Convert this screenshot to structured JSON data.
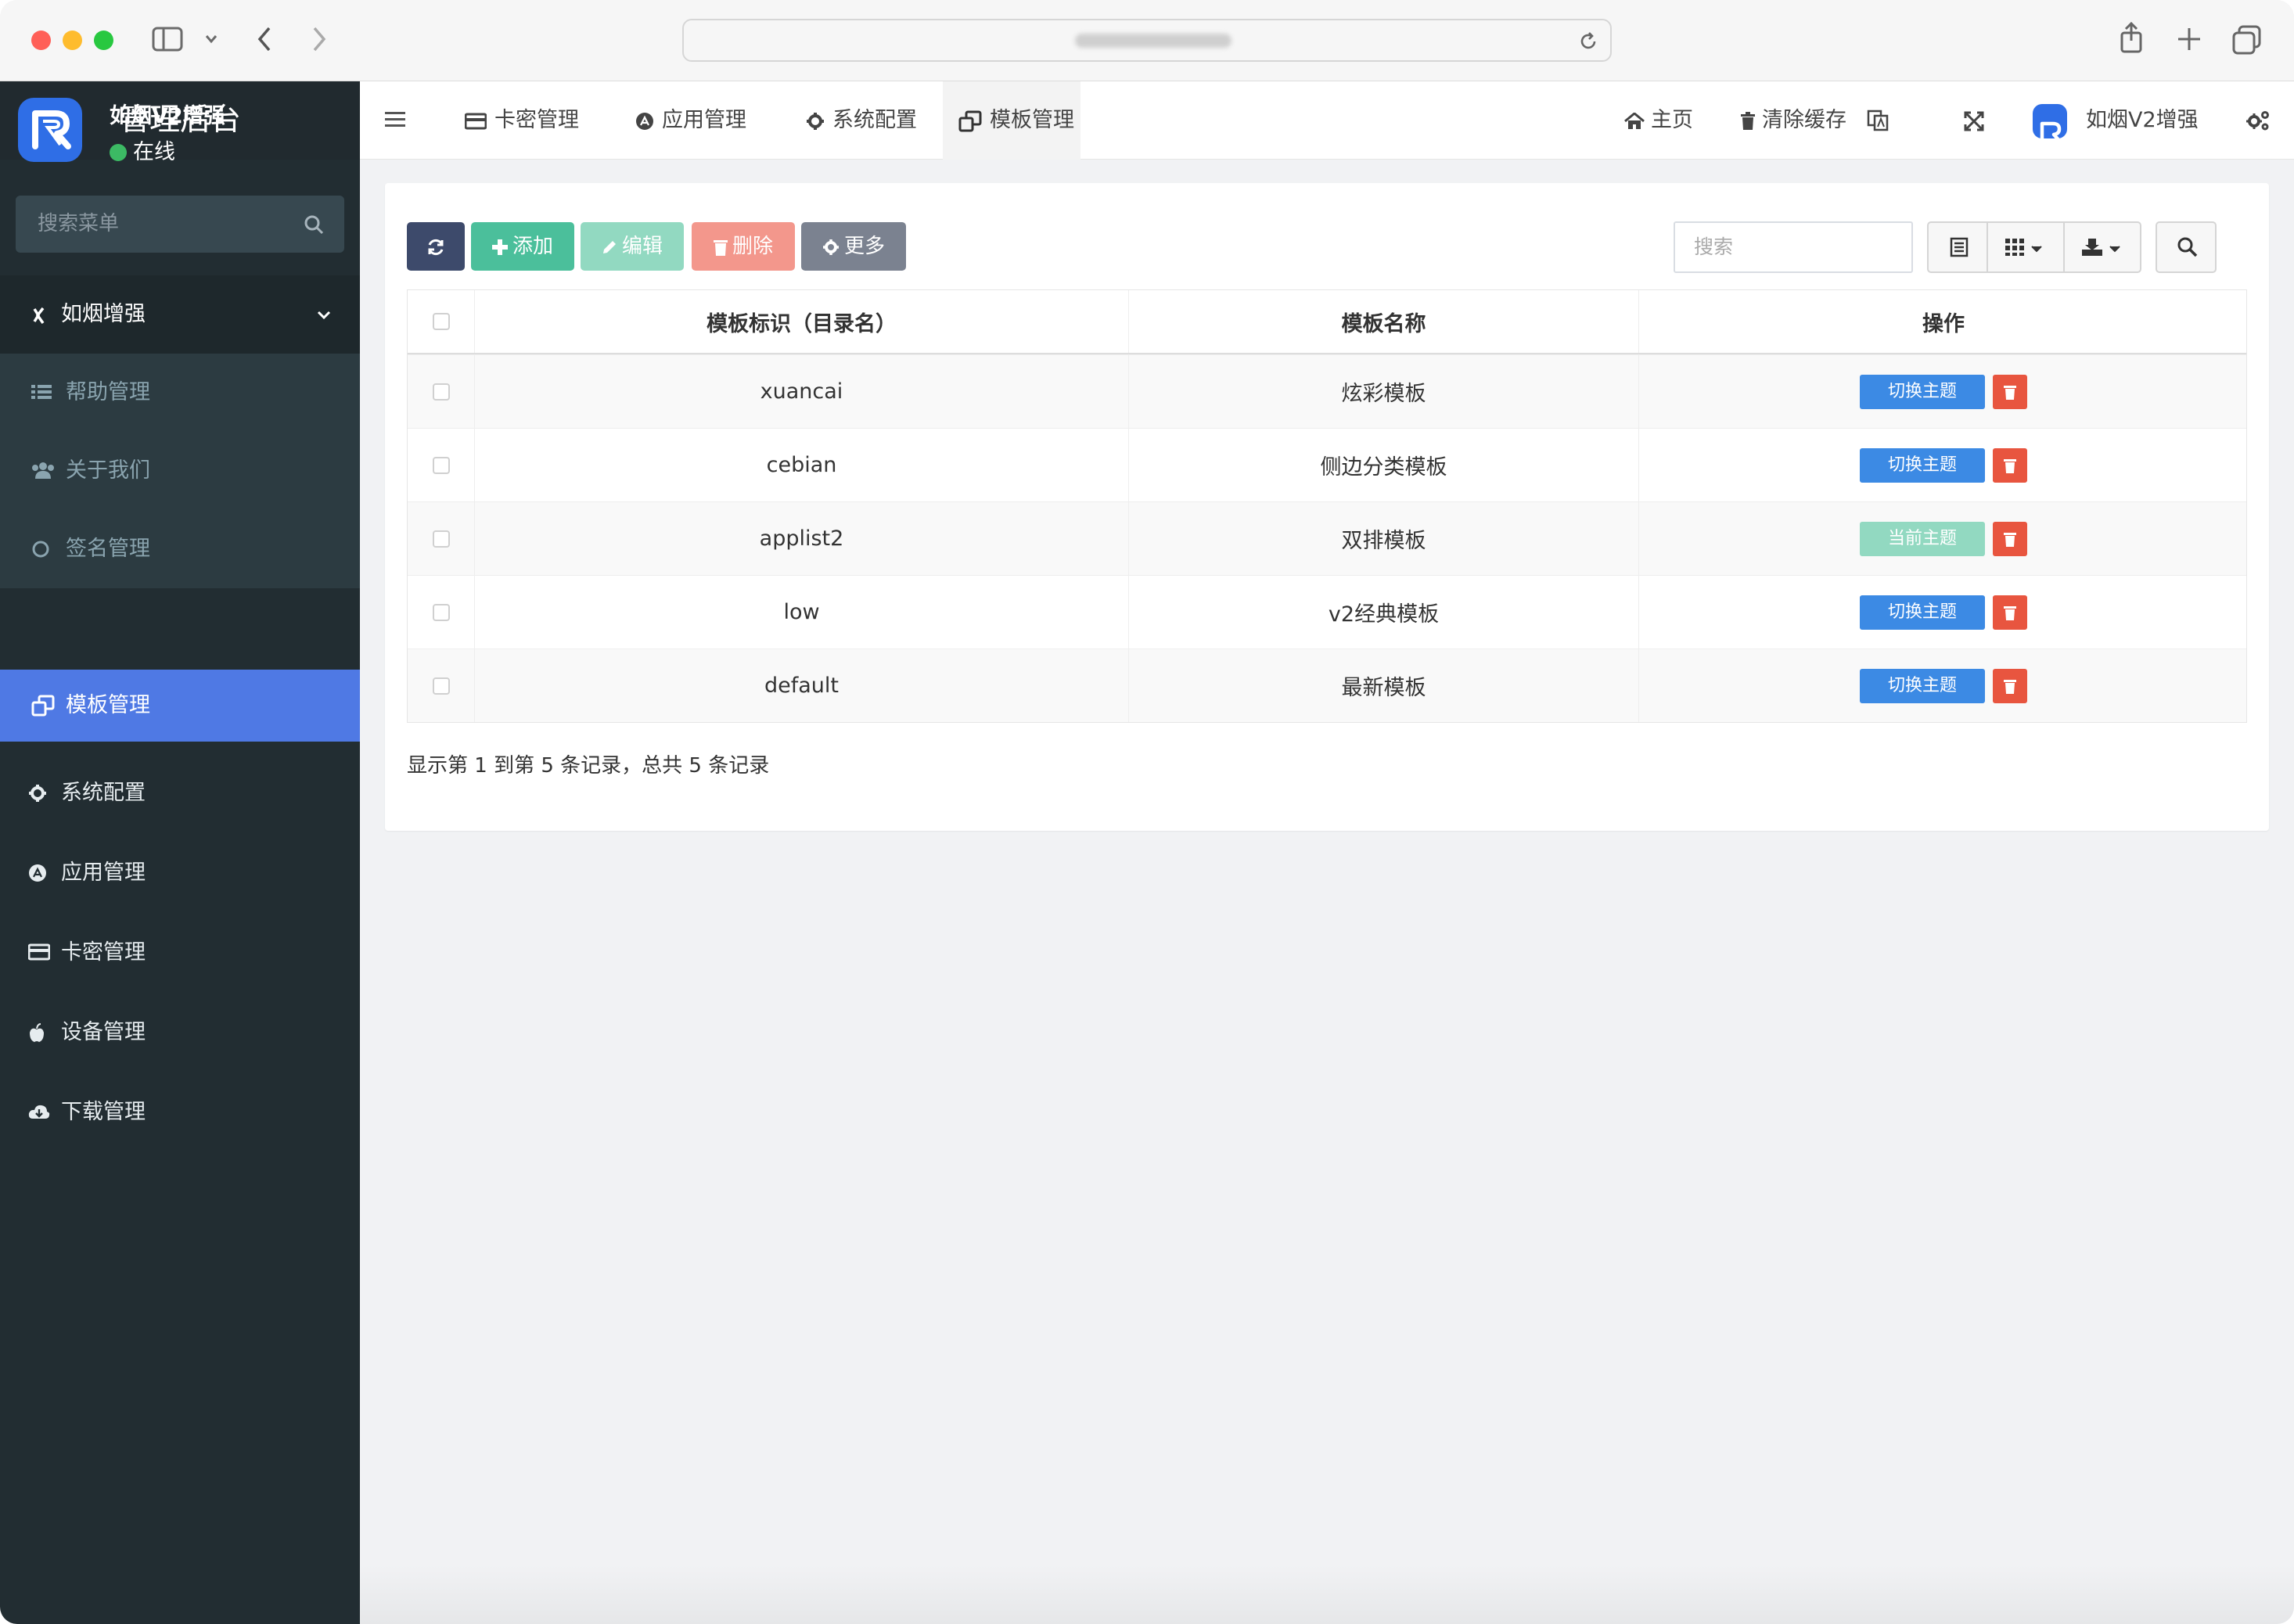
{
  "browser": {
    "traffic_lights": [
      "#ff5f57",
      "#febc2e",
      "#28c840"
    ]
  },
  "sidebar": {
    "title": "管理后台",
    "user": {
      "name": "如烟V2增强",
      "status": "在线"
    },
    "search_placeholder": "搜索菜单",
    "group": {
      "label": "如烟增强",
      "icon": "xing-icon"
    },
    "submenu": [
      {
        "label": "帮助管理",
        "icon": "list-icon"
      },
      {
        "label": "关于我们",
        "icon": "users-icon"
      },
      {
        "label": "签名管理",
        "icon": "circle-icon"
      }
    ],
    "active_item": {
      "label": "模板管理",
      "icon": "clone-icon"
    },
    "items": [
      {
        "label": "系统配置",
        "icon": "gear-icon"
      },
      {
        "label": "应用管理",
        "icon": "app-store-icon"
      },
      {
        "label": "卡密管理",
        "icon": "credit-card-icon"
      },
      {
        "label": "设备管理",
        "icon": "apple-icon"
      },
      {
        "label": "下载管理",
        "icon": "cloud-download-icon"
      }
    ]
  },
  "navbar": {
    "tabs": [
      {
        "label": "卡密管理",
        "icon": "credit-card-icon"
      },
      {
        "label": "应用管理",
        "icon": "app-store-icon"
      },
      {
        "label": "系统配置",
        "icon": "gear-icon"
      },
      {
        "label": "模板管理",
        "icon": "clone-icon",
        "active": true
      }
    ],
    "right": {
      "home": "主页",
      "clear_cache": "清除缓存",
      "user": "如烟V2增强"
    }
  },
  "toolbar": {
    "add": "添加",
    "edit": "编辑",
    "delete": "删除",
    "more": "更多",
    "search_placeholder": "搜索",
    "colors": {
      "refresh": "#3d4a6b",
      "add": "#4bbf9b",
      "edit": "#92d9c1",
      "delete": "#f3978c",
      "more": "#7b8290"
    }
  },
  "table": {
    "columns": [
      "模板标识（目录名）",
      "模板名称",
      "操作"
    ],
    "rows": [
      {
        "id": "xuancai",
        "name": "炫彩模板",
        "action": "切换主题",
        "current": false
      },
      {
        "id": "cebian",
        "name": "侧边分类模板",
        "action": "切换主题",
        "current": false
      },
      {
        "id": "applist2",
        "name": "双排模板",
        "action": "当前主题",
        "current": true
      },
      {
        "id": "low",
        "name": "v2经典模板",
        "action": "切换主题",
        "current": false
      },
      {
        "id": "default",
        "name": "最新模板",
        "action": "切换主题",
        "current": false
      }
    ],
    "footer": "显示第 1 到第 5 条记录，总共 5 条记录"
  }
}
